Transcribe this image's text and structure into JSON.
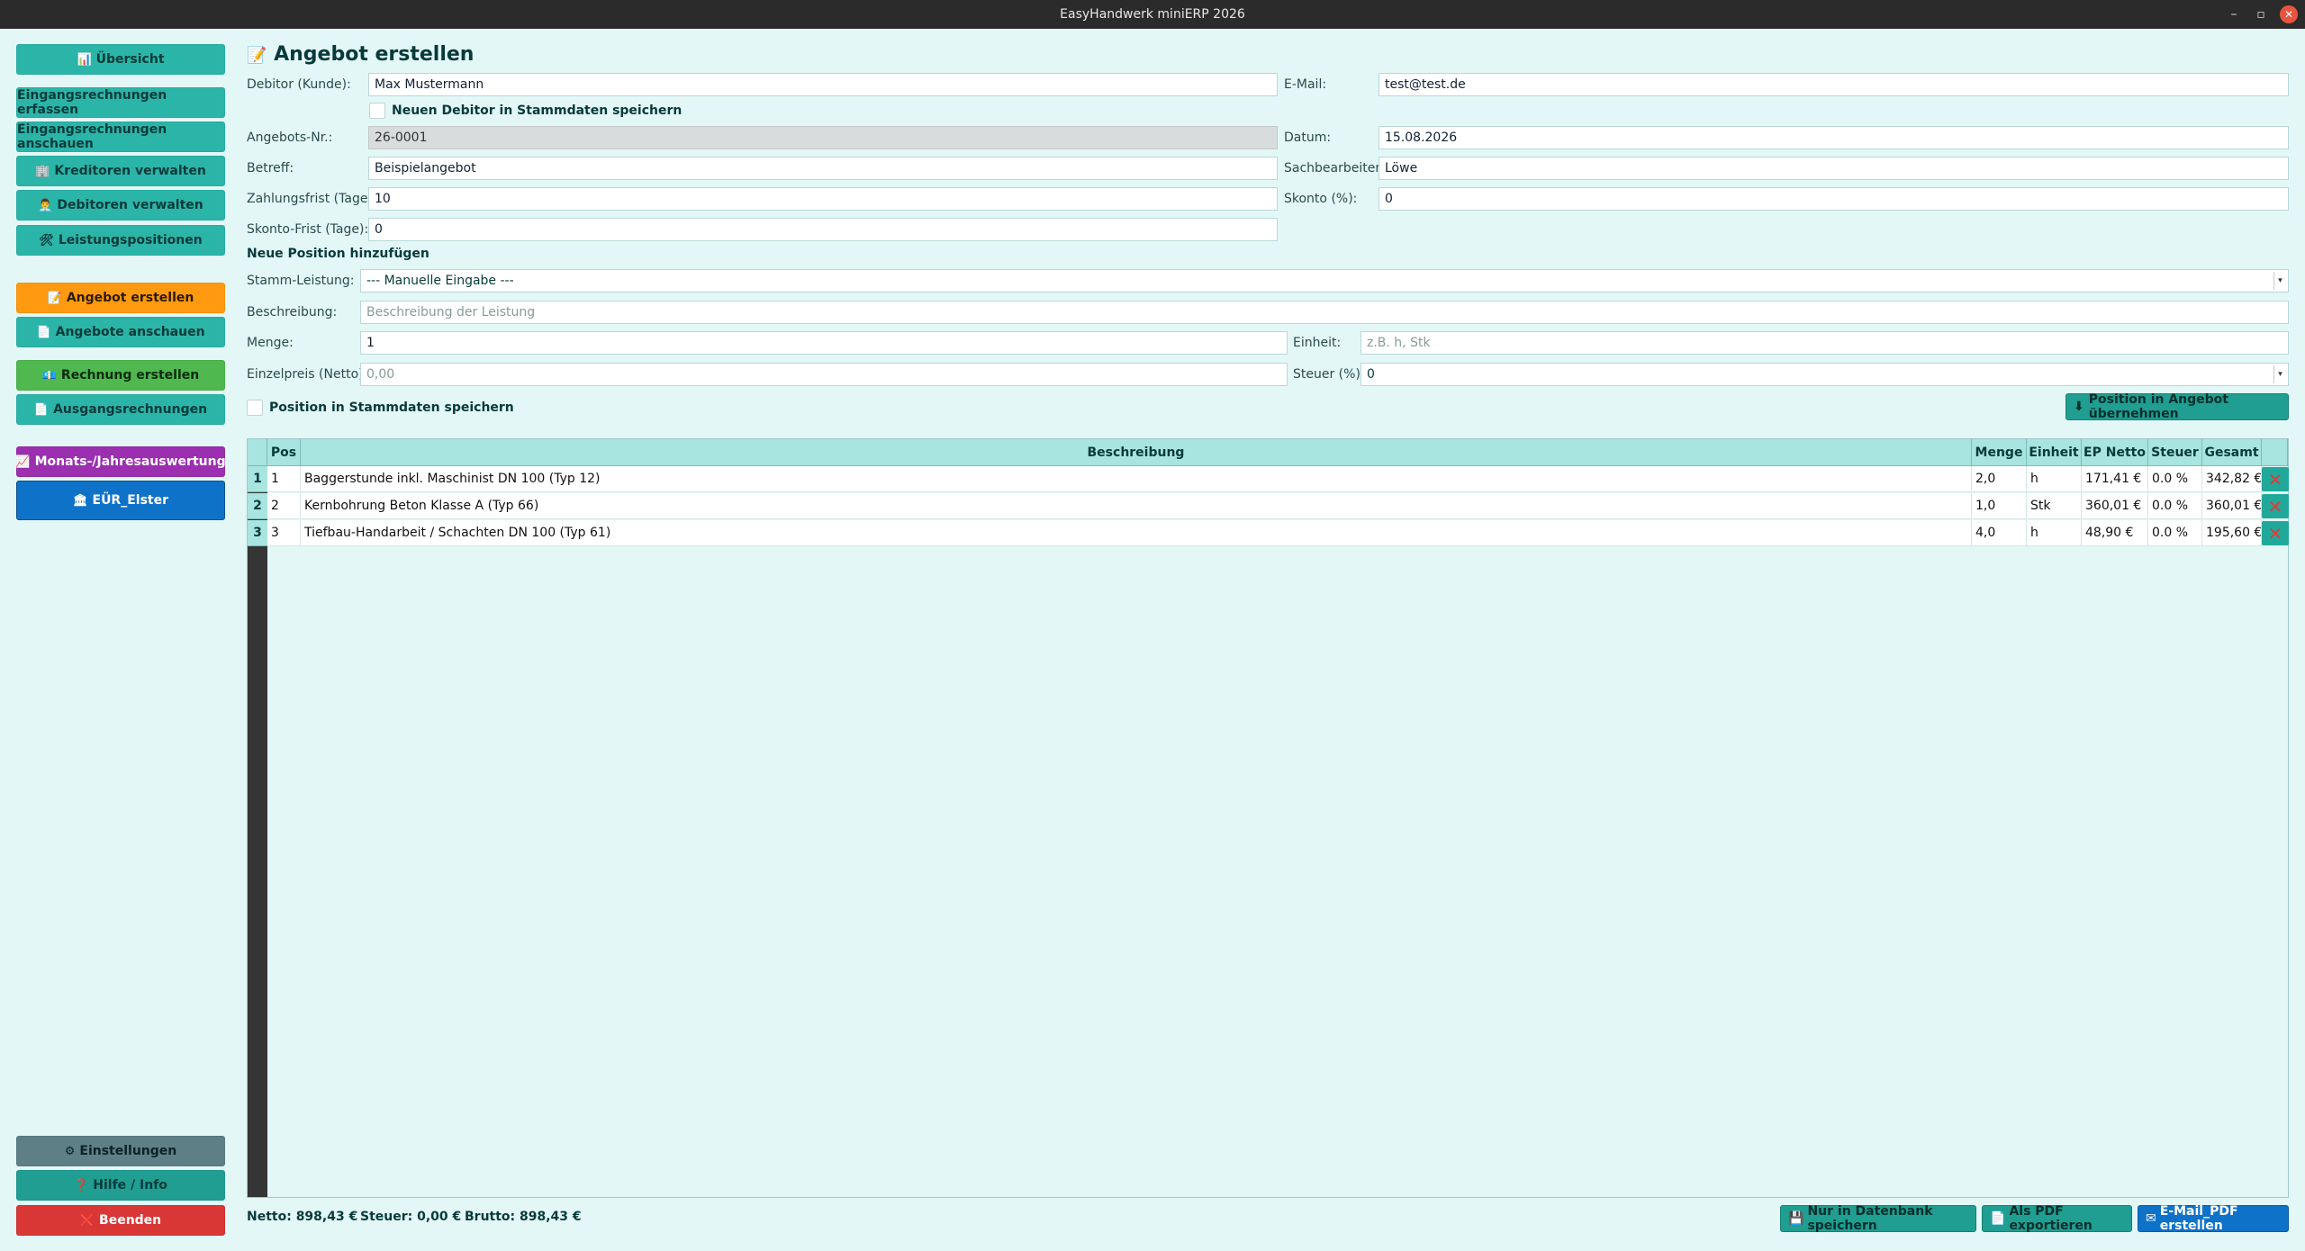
{
  "window": {
    "title": "EasyHandwerk miniERP 2026"
  },
  "sidebar": {
    "overview": {
      "icon": "📊",
      "label": "Übersicht"
    },
    "incoming_capture": {
      "label": "Eingangsrechnungen erfassen"
    },
    "incoming_view": {
      "label": "Eingangsrechnungen anschauen"
    },
    "creditors": {
      "icon": "🏢",
      "label": "Kreditoren verwalten"
    },
    "debtors": {
      "icon": "👨‍💼",
      "label": "Debitoren verwalten"
    },
    "services": {
      "icon": "🛠",
      "label": "Leistungspositionen"
    },
    "offer_create": {
      "icon": "📝",
      "label": "Angebot erstellen"
    },
    "offers_view": {
      "icon": "📄",
      "label": "Angebote anschauen"
    },
    "invoice_create": {
      "icon": "💶",
      "label": "Rechnung erstellen"
    },
    "outgoing": {
      "icon": "📄",
      "label": "Ausgangsrechnungen"
    },
    "evaluation": {
      "icon": "📈",
      "label": "Monats-/Jahresauswertung"
    },
    "eur": {
      "icon": "🏛",
      "label": "EÜR_Elster"
    },
    "settings": {
      "icon": "⚙",
      "label": "Einstellungen"
    },
    "help": {
      "icon": "❓",
      "label": "Hilfe / Info"
    },
    "quit": {
      "icon": "❌",
      "label": "Beenden"
    }
  },
  "form": {
    "title_icon": "📝",
    "title": "Angebot erstellen",
    "debtor_label": "Debitor (Kunde):",
    "debtor_value": "Max Mustermann",
    "email_label": "E-Mail:",
    "email_value": "test@test.de",
    "save_debtor_label": "Neuen Debitor in Stammdaten speichern",
    "offer_no_label": "Angebots-Nr.:",
    "offer_no_value": "26-0001",
    "date_label": "Datum:",
    "date_value": "15.08.2026",
    "subject_label": "Betreff:",
    "subject_value": "Beispielangebot",
    "clerk_label": "Sachbearbeiter:",
    "clerk_value": "Löwe",
    "payment_term_label": "Zahlungsfrist (Tage):",
    "payment_term_value": "10",
    "discount_label": "Skonto (%):",
    "discount_value": "0",
    "discount_term_label": "Skonto-Frist (Tage):",
    "discount_term_value": "0"
  },
  "new_position": {
    "section_title": "Neue Position hinzufügen",
    "master_label": "Stamm-Leistung:",
    "master_value": "--- Manuelle Eingabe ---",
    "description_label": "Beschreibung:",
    "description_placeholder": "Beschreibung der Leistung",
    "quantity_label": "Menge:",
    "quantity_value": "1",
    "unit_label": "Einheit:",
    "unit_placeholder": "z.B. h, Stk",
    "price_label": "Einzelpreis (Netto):",
    "price_placeholder": "0,00",
    "tax_label": "Steuer (%):",
    "tax_value": "0",
    "save_position_label": "Position in Stammdaten speichern",
    "add_button_icon": "⬇",
    "add_button_label": "Position in Angebot übernehmen"
  },
  "table": {
    "headers": {
      "pos": "Pos",
      "description": "Beschreibung",
      "quantity": "Menge",
      "unit": "Einheit",
      "ep_netto": "EP Netto",
      "tax": "Steuer",
      "total": "Gesamt"
    },
    "rows": [
      {
        "row": "1",
        "pos": "1",
        "description": "Baggerstunde inkl. Maschinist DN 100 (Typ 12)",
        "quantity": "2,0",
        "unit": "h",
        "ep_netto": "171,41 €",
        "tax": "0.0 %",
        "total": "342,82 €",
        "delete_icon": "✕"
      },
      {
        "row": "2",
        "pos": "2",
        "description": "Kernbohrung Beton Klasse A (Typ 66)",
        "quantity": "1,0",
        "unit": "Stk",
        "ep_netto": "360,01 €",
        "tax": "0.0 %",
        "total": "360,01 €",
        "delete_icon": "✕"
      },
      {
        "row": "3",
        "pos": "3",
        "description": "Tiefbau-Handarbeit / Schachten DN 100 (Typ 61)",
        "quantity": "4,0",
        "unit": "h",
        "ep_netto": "48,90 €",
        "tax": "0.0 %",
        "total": "195,60 €",
        "delete_icon": "✕"
      }
    ]
  },
  "footer": {
    "netto": "Netto: 898,43 €",
    "tax": "Steuer: 0,00 €",
    "brutto": "Brutto: 898,43 €",
    "db_save_icon": "💾",
    "db_save_label": "Nur in Datenbank speichern",
    "pdf_icon": "📄",
    "pdf_label": "Als PDF exportieren",
    "email_icon": "✉",
    "email_label": "E-Mail_PDF erstellen"
  }
}
